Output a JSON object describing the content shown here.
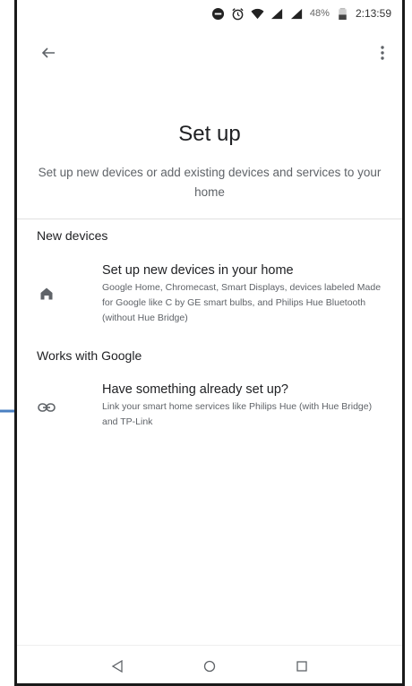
{
  "status_bar": {
    "battery": "48%",
    "time": "2:13:59"
  },
  "header": {
    "title": "Set up",
    "subtitle": "Set up new devices or add existing devices and services to your home"
  },
  "sections": {
    "new_devices": {
      "header": "New devices",
      "item": {
        "title": "Set up new devices in your home",
        "description": "Google Home, Chromecast, Smart Displays, devices labeled Made for Google like C by GE smart bulbs, and Philips Hue Bluetooth (without Hue Bridge)",
        "icon": "home-icon"
      }
    },
    "works_with_google": {
      "header": "Works with Google",
      "item": {
        "title": "Have something already set up?",
        "description": "Link your smart home services like Philips Hue (with Hue Bridge) and TP-Link",
        "icon": "link-icon"
      }
    }
  },
  "colors": {
    "annotation_arrow": "#4a7fc1",
    "text_primary": "#202124",
    "text_secondary": "#5f6368"
  }
}
